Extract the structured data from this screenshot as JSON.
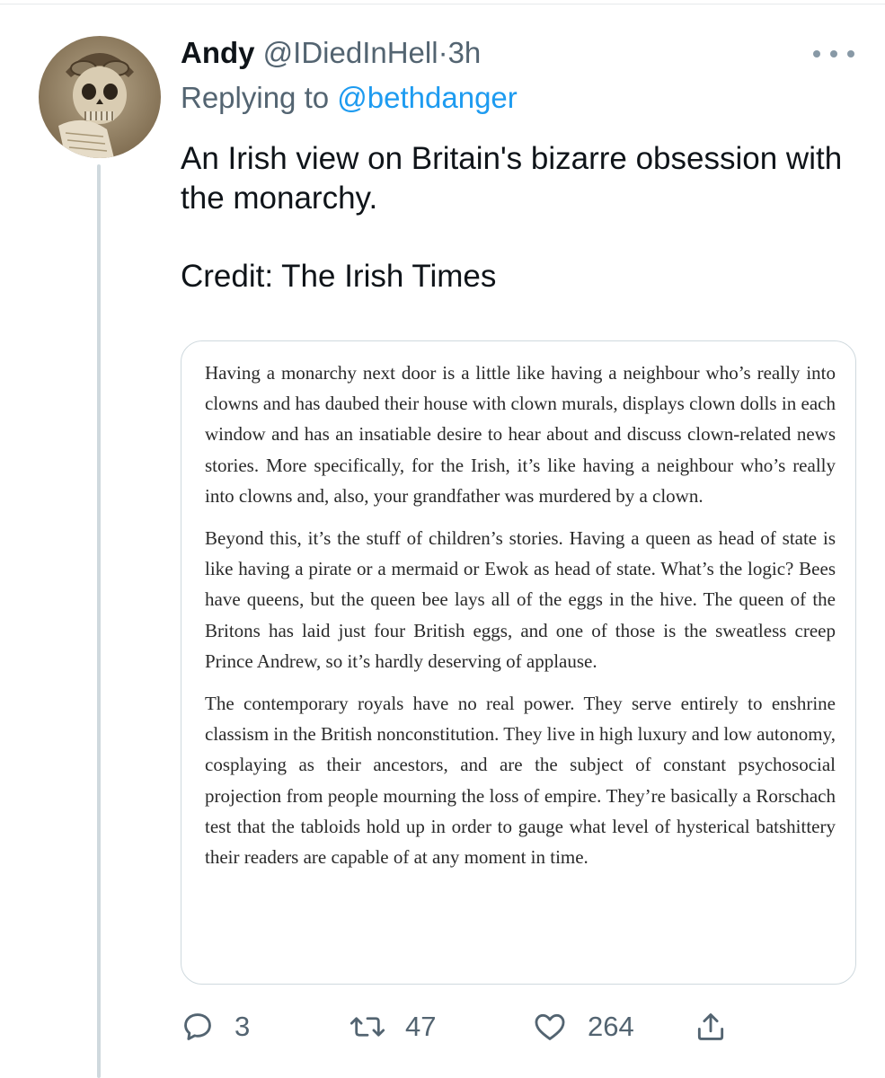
{
  "tweet": {
    "display_name": "Andy",
    "handle": "@IDiedInHell",
    "separator": "·",
    "time": "3h",
    "replying_prefix": "Replying to",
    "replying_to": "@bethdanger",
    "text_line1": "An Irish view on Britain's bizarre obsession with the monarchy.",
    "text_credit": "Credit: The Irish Times",
    "avatar_icon": "skull-aviator-avatar",
    "more_icon": "more-horizontal-icon"
  },
  "article": {
    "paragraphs": [
      "Having a monarchy next door is a little like having a neighbour who’s really into clowns and has daubed their house with clown murals, displays clown dolls in each window and has an insatiable desire to hear about and discuss clown-related news stories. More specifically, for the Irish, it’s like having a neighbour who’s really into clowns and, also, your grandfather was murdered by a clown.",
      "Beyond this, it’s the stuff of children’s stories. Having a queen as head of state is like having a pirate or a mermaid or Ewok as head of state. What’s the logic? Bees have queens, but the queen bee lays all of the eggs in the hive. The queen of the Britons has laid just four British eggs, and one of those is the sweatless creep Prince Andrew, so it’s hardly deserving of applause.",
      "The contemporary royals have no real power. They serve entirely to enshrine classism in the British nonconstitution. They live in high luxury and low autonomy, cosplaying as their ancestors, and are the subject of constant psychosocial projection from people mourning the loss of empire. They’re basically a Rorschach test that the tabloids hold up in order to gauge what level of hysterical batshittery their readers are capable of at any moment in time."
    ]
  },
  "actions": {
    "reply_count": "3",
    "retweet_count": "47",
    "like_count": "264",
    "icons": [
      "reply-icon",
      "retweet-icon",
      "like-icon",
      "share-icon"
    ]
  },
  "colors": {
    "text": "#0f1419",
    "secondary": "#536471",
    "link": "#1d9bf0",
    "border": "#cfd9de"
  }
}
